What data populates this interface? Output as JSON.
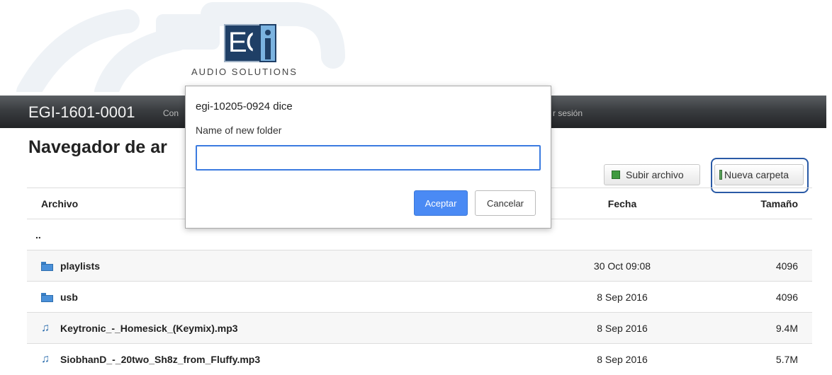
{
  "logo": {
    "letters": "EGi",
    "tagline": "AUDIO SOLUTIONS"
  },
  "navbar": {
    "title": "EGI-1601-0001",
    "link_partial_left": "Con",
    "link_partial_right": "r sesión"
  },
  "page": {
    "title": "Navegador de ar"
  },
  "toolbar": {
    "upload_label": "Subir archivo",
    "new_folder_label": "Nueva carpeta"
  },
  "table": {
    "headers": {
      "name": "Archivo",
      "date": "Fecha",
      "size": "Tamaño"
    },
    "parent": "..",
    "rows": [
      {
        "name": "playlists",
        "date": "30 Oct 09:08",
        "size": "4096",
        "icon": "folder-icon"
      },
      {
        "name": "usb",
        "date": "8 Sep 2016",
        "size": "4096",
        "icon": "folder-icon"
      },
      {
        "name": "Keytronic_-_Homesick_(Keymix).mp3",
        "date": "8 Sep 2016",
        "size": "9.4M",
        "icon": "music-file-icon"
      },
      {
        "name": "SiobhanD_-_20two_Sh8z_from_Fluffy.mp3",
        "date": "8 Sep 2016",
        "size": "5.7M",
        "icon": "music-file-icon"
      }
    ]
  },
  "dialog": {
    "title": "egi-10205-0924 dice",
    "message": "Name of new folder",
    "input_value": "",
    "ok_label": "Aceptar",
    "cancel_label": "Cancelar"
  },
  "colors": {
    "accent_blue": "#4a8af4",
    "highlight_border": "#2a5aa6",
    "navbar_dark": "#2b2d2f"
  }
}
